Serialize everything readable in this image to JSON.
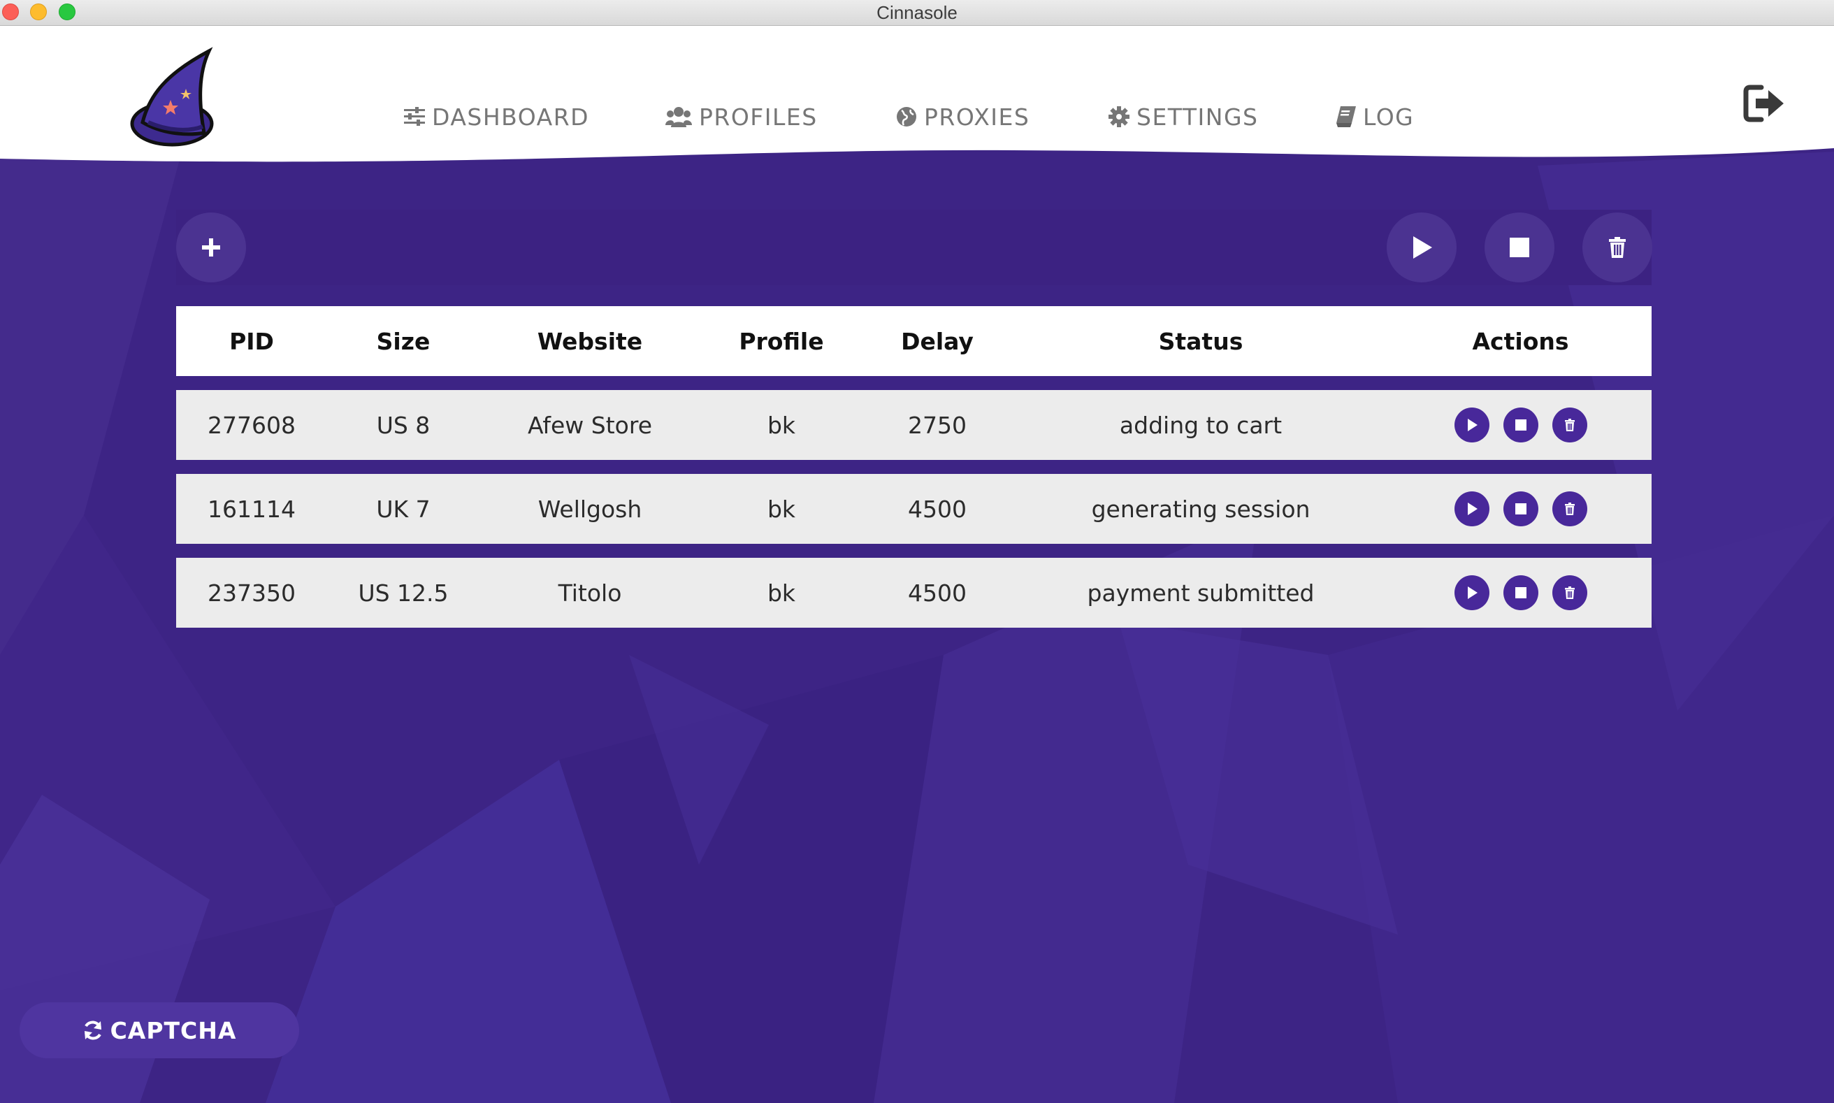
{
  "window": {
    "title": "Cinnasole"
  },
  "nav": {
    "items": [
      {
        "label": "DASHBOARD",
        "icon": "sliders-icon"
      },
      {
        "label": "PROFILES",
        "icon": "users-icon"
      },
      {
        "label": "PROXIES",
        "icon": "globe-icon"
      },
      {
        "label": "SETTINGS",
        "icon": "gear-icon"
      },
      {
        "label": "LOG",
        "icon": "book-icon"
      }
    ],
    "logout_icon": "sign-out-icon",
    "logo_icon": "wizard-hat-icon"
  },
  "toolbar": {
    "add_icon": "plus-icon",
    "start_all_icon": "play-icon",
    "stop_all_icon": "stop-icon",
    "delete_all_icon": "trash-icon"
  },
  "table": {
    "columns": [
      "PID",
      "Size",
      "Website",
      "Profile",
      "Delay",
      "Status",
      "Actions"
    ],
    "rows": [
      {
        "pid": "277608",
        "size": "US 8",
        "website": "Afew Store",
        "profile": "bk",
        "delay": "2750",
        "status": "adding to cart"
      },
      {
        "pid": "161114",
        "size": "UK 7",
        "website": "Wellgosh",
        "profile": "bk",
        "delay": "4500",
        "status": "generating session"
      },
      {
        "pid": "237350",
        "size": "US 12.5",
        "website": "Titolo",
        "profile": "bk",
        "delay": "4500",
        "status": "payment submitted"
      }
    ]
  },
  "captcha": {
    "label": "CAPTCHA",
    "icon": "refresh-icon"
  },
  "colors": {
    "primary": "#3b2383",
    "button": "#4b3391",
    "row_bg": "#ececec",
    "nav_text": "#767676"
  }
}
